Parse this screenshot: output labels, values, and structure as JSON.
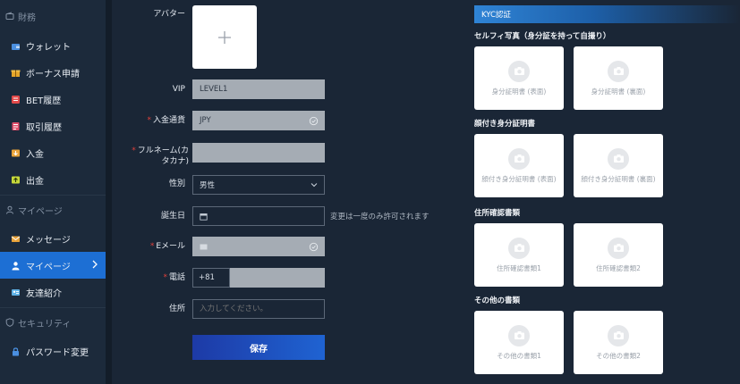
{
  "sidebar": {
    "sections": [
      {
        "label": "財務",
        "icon": "wallet-section-icon"
      },
      {
        "label": "マイページ",
        "icon": "user-section-icon"
      },
      {
        "label": "セキュリティ",
        "icon": "shield-section-icon"
      }
    ],
    "items": [
      {
        "label": "ウォレット",
        "icon": "wallet-icon"
      },
      {
        "label": "ボーナス申請",
        "icon": "gift-icon"
      },
      {
        "label": "BET履歴",
        "icon": "bet-history-icon"
      },
      {
        "label": "取引履歴",
        "icon": "transaction-icon"
      },
      {
        "label": "入金",
        "icon": "deposit-icon"
      },
      {
        "label": "出金",
        "icon": "withdraw-icon"
      },
      {
        "label": "メッセージ",
        "icon": "mail-icon"
      },
      {
        "label": "マイページ",
        "icon": "user-icon"
      },
      {
        "label": "友達紹介",
        "icon": "friend-icon"
      },
      {
        "label": "パスワード変更",
        "icon": "lock-icon"
      }
    ],
    "active_item": "マイページ",
    "accent": "#1d6fd4"
  },
  "form": {
    "avatar_label": "アバター",
    "vip_label": "VIP",
    "vip_value": "LEVEL1",
    "currency_label": "入金通貨",
    "currency_value": "JPY",
    "fullname_label_1": "フルネーム(カ",
    "fullname_label_2": "タカナ)",
    "gender_label": "性別",
    "gender_value": "男性",
    "birthday_label": "誕生日",
    "birthday_hint": "変更は一度のみ許可されます",
    "email_label": "Eメール",
    "phone_label": "電話",
    "phone_prefix": "+81",
    "address_label": "住所",
    "address_placeholder": "入力してください。",
    "save_label": "保存"
  },
  "kyc": {
    "header": "KYC認証",
    "groups": [
      {
        "title": "セルフィ写真（身分証を持って自撮り）",
        "cards": [
          "身分証明書 (表面)",
          "身分証明書 (裏面)"
        ]
      },
      {
        "title": "顔付き身分証明書",
        "cards": [
          "顔付き身分証明書 (表面)",
          "顔付き身分証明書 (裏面)"
        ]
      },
      {
        "title": "住所確認書類",
        "cards": [
          "住所確認書類1",
          "住所確認書類2"
        ]
      },
      {
        "title": "その他の書類",
        "cards": [
          "その他の書類1",
          "その他の書類2"
        ]
      }
    ]
  }
}
